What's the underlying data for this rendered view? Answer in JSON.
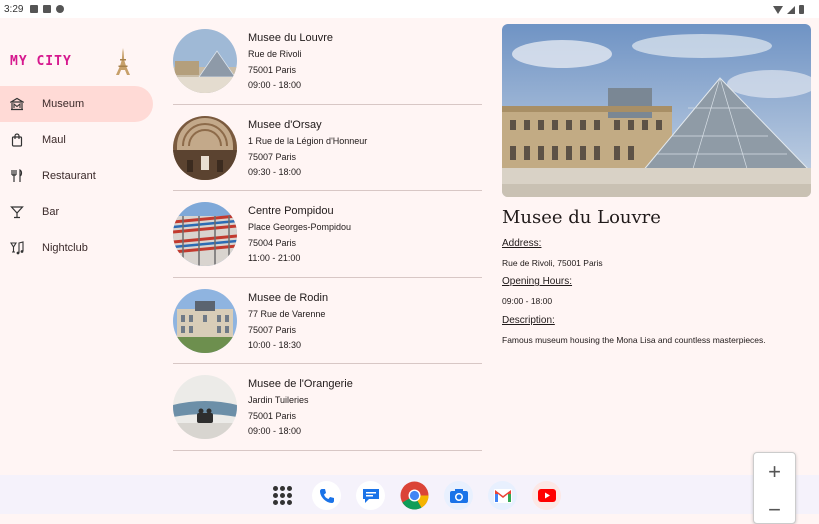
{
  "status_bar": {
    "time": "3:29"
  },
  "app": {
    "brand": "MY CITY"
  },
  "nav": {
    "items": [
      {
        "label": "Museum",
        "icon": "museum-icon",
        "active": true
      },
      {
        "label": "Maul",
        "icon": "shopping-bag-icon",
        "active": false
      },
      {
        "label": "Restaurant",
        "icon": "restaurant-icon",
        "active": false
      },
      {
        "label": "Bar",
        "icon": "bar-icon",
        "active": false
      },
      {
        "label": "Nightclub",
        "icon": "nightclub-icon",
        "active": false
      }
    ]
  },
  "places": [
    {
      "name": "Musee du Louvre",
      "address": "Rue de Rivoli",
      "city": "75001 Paris",
      "hours": "09:00 - 18:00"
    },
    {
      "name": "Musee d'Orsay",
      "address": "1 Rue de la Légion d'Honneur",
      "city": "75007 Paris",
      "hours": "09:30 - 18:00"
    },
    {
      "name": "Centre Pompidou",
      "address": "Place Georges-Pompidou",
      "city": "75004 Paris",
      "hours": "11:00 - 21:00"
    },
    {
      "name": "Musee de Rodin",
      "address": "77 Rue de Varenne",
      "city": "75007 Paris",
      "hours": "10:00 - 18:30"
    },
    {
      "name": "Musee de l'Orangerie",
      "address": "Jardin Tuileries",
      "city": "75001 Paris",
      "hours": "09:00 - 18:00"
    }
  ],
  "detail": {
    "title": "Musee du Louvre",
    "address_label": "Address:",
    "address": "Rue de Rivoli, 75001 Paris",
    "hours_label": "Opening Hours:",
    "hours": "09:00 - 18:00",
    "description_label": "Description:",
    "description": "Famous museum housing the Mona Lisa and countless masterpieces."
  },
  "dock": [
    "apps-grid-icon",
    "phone-icon",
    "messages-icon",
    "chrome-icon",
    "camera-icon",
    "gmail-icon",
    "youtube-icon"
  ],
  "zoom": {
    "plus": "+",
    "minus": "−"
  },
  "colors": {
    "brand": "#d6188e",
    "active_nav": "#ffdad6",
    "background": "#fff5f4"
  }
}
